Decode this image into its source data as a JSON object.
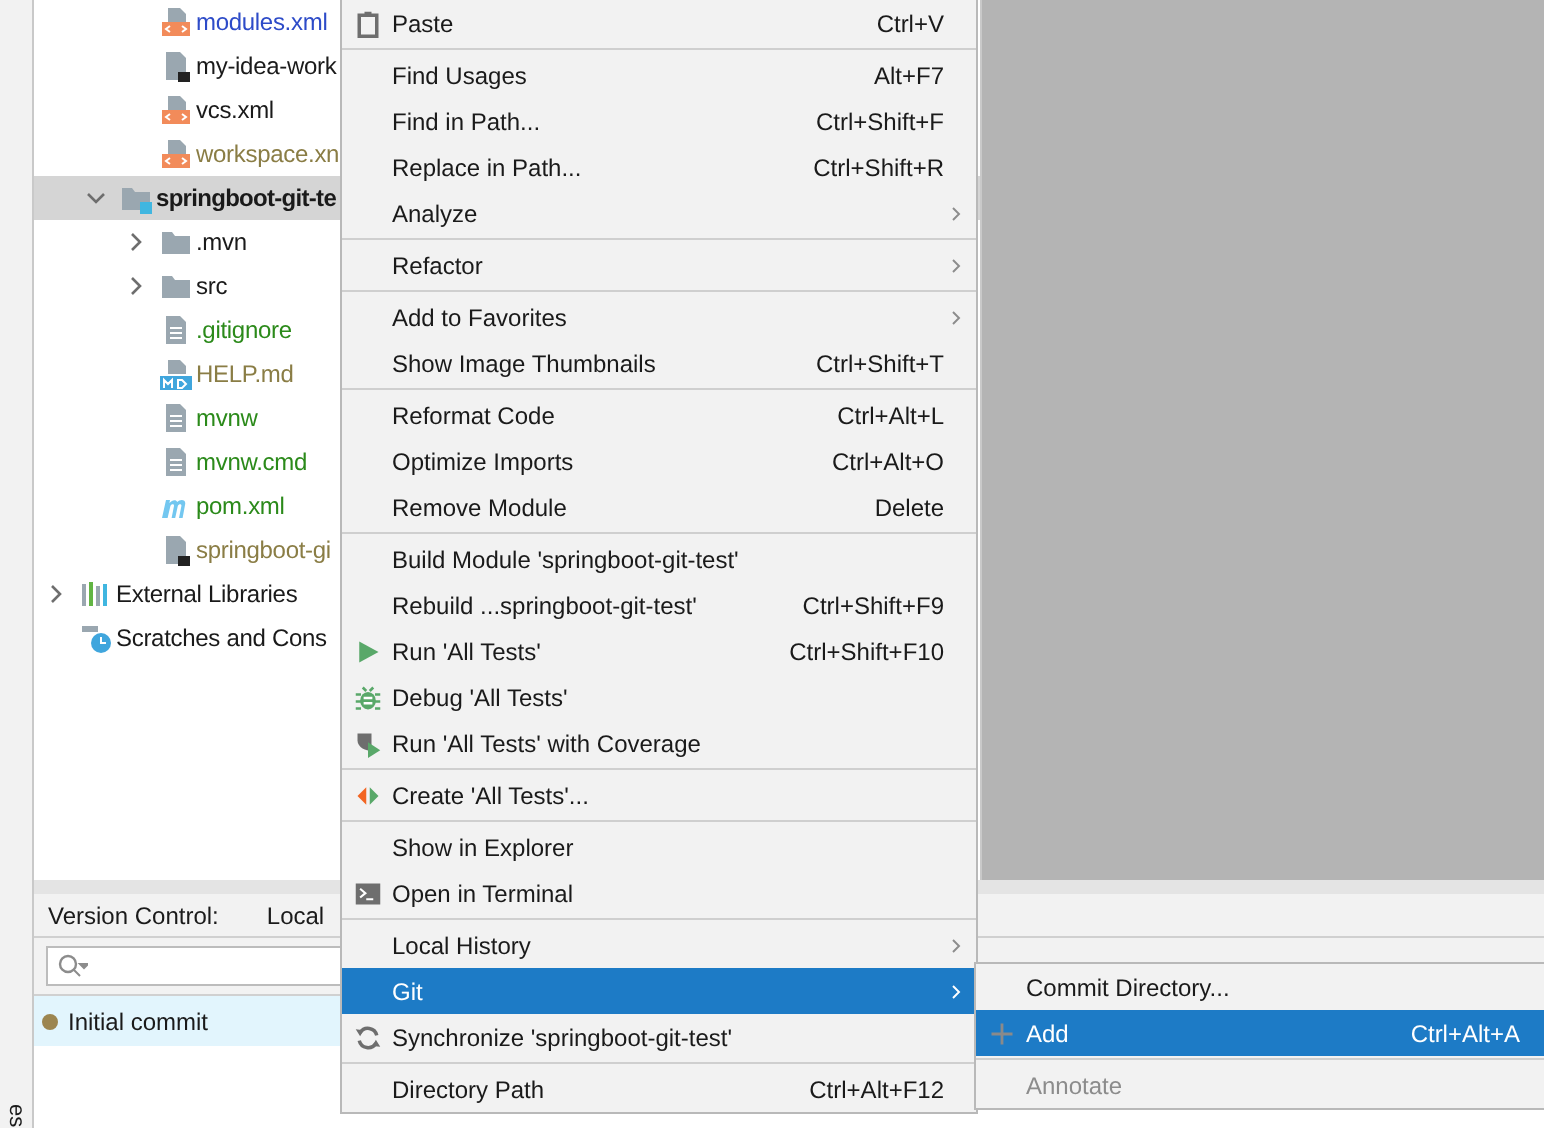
{
  "side_strip": {
    "label": "es"
  },
  "project_tree": [
    {
      "children": [
        {
          "children": [
            {
              "name": "modules.xml",
              "kind": "xml",
              "color": "#2d4bc8",
              "selected": false
            },
            {
              "name": "my-idea-work",
              "kind": "hidden-file",
              "color": "#1a1a1a",
              "selected": false
            },
            {
              "name": "vcs.xml",
              "kind": "xml",
              "color": "#1a1a1a",
              "selected": false
            },
            {
              "name": "workspace.xn",
              "kind": "xml",
              "color": "#8a7d45",
              "selected": false
            }
          ]
        },
        {
          "name": "springboot-git-te",
          "kind": "module",
          "color": "#1a1a1a",
          "expanded": true,
          "selected": true,
          "children": [
            {
              "name": ".mvn",
              "kind": "folder",
              "color": "#1a1a1a",
              "expanded": false,
              "selected": false
            },
            {
              "name": "src",
              "kind": "folder",
              "color": "#1a1a1a",
              "expanded": false,
              "selected": false
            },
            {
              "name": ".gitignore",
              "kind": "text",
              "color": "#2b8a1a",
              "selected": false
            },
            {
              "name": "HELP.md",
              "kind": "md",
              "color": "#8a7d45",
              "selected": false
            },
            {
              "name": "mvnw",
              "kind": "text",
              "color": "#2b8a1a",
              "selected": false
            },
            {
              "name": "mvnw.cmd",
              "kind": "text",
              "color": "#2b8a1a",
              "selected": false
            },
            {
              "name": "pom.xml",
              "kind": "maven",
              "color": "#2b8a1a",
              "selected": false
            },
            {
              "name": "springboot-gi",
              "kind": "hidden-file",
              "color": "#8a7d45",
              "selected": false
            }
          ]
        }
      ]
    },
    {
      "name": "External Libraries",
      "kind": "libraries",
      "color": "#1a1a1a",
      "expanded": false,
      "selected": false
    },
    {
      "name": "Scratches and Cons",
      "kind": "scratches",
      "color": "#1a1a1a",
      "selected": false
    }
  ],
  "version_control": {
    "title": "Version Control:",
    "tabs": [
      {
        "label": "Local",
        "selected": false
      }
    ],
    "commits": [
      {
        "message": "Initial commit",
        "color": "#9c8550",
        "selected": true
      }
    ]
  },
  "context_menu": {
    "groups": [
      [
        {
          "label": "Paste",
          "shortcut": "Ctrl+V",
          "kind": "paste",
          "submenu": false,
          "selected": false
        }
      ],
      [
        {
          "label": "Find Usages",
          "shortcut": "Alt+F7",
          "submenu": false,
          "selected": false
        },
        {
          "label": "Find in Path...",
          "shortcut": "Ctrl+Shift+F",
          "submenu": false,
          "selected": false
        },
        {
          "label": "Replace in Path...",
          "shortcut": "Ctrl+Shift+R",
          "submenu": false,
          "selected": false
        },
        {
          "label": "Analyze",
          "submenu": true,
          "selected": false
        }
      ],
      [
        {
          "label": "Refactor",
          "submenu": true,
          "selected": false
        }
      ],
      [
        {
          "label": "Add to Favorites",
          "submenu": true,
          "selected": false
        },
        {
          "label": "Show Image Thumbnails",
          "shortcut": "Ctrl+Shift+T",
          "submenu": false,
          "selected": false
        }
      ],
      [
        {
          "label": "Reformat Code",
          "shortcut": "Ctrl+Alt+L",
          "submenu": false,
          "selected": false
        },
        {
          "label": "Optimize Imports",
          "shortcut": "Ctrl+Alt+O",
          "submenu": false,
          "selected": false
        },
        {
          "label": "Remove Module",
          "shortcut": "Delete",
          "submenu": false,
          "selected": false
        }
      ],
      [
        {
          "label": "Build Module 'springboot-git-test'",
          "submenu": false,
          "selected": false
        },
        {
          "label": "Rebuild ...springboot-git-test'",
          "shortcut": "Ctrl+Shift+F9",
          "submenu": false,
          "selected": false
        },
        {
          "label": "Run 'All Tests'",
          "shortcut": "Ctrl+Shift+F10",
          "kind": "run",
          "submenu": false,
          "selected": false
        },
        {
          "label": "Debug 'All Tests'",
          "kind": "debug",
          "submenu": false,
          "selected": false
        },
        {
          "label": "Run 'All Tests' with Coverage",
          "kind": "coverage",
          "submenu": false,
          "selected": false
        }
      ],
      [
        {
          "label": "Create 'All Tests'...",
          "kind": "create",
          "submenu": false,
          "selected": false
        }
      ],
      [
        {
          "label": "Show in Explorer",
          "submenu": false,
          "selected": false
        },
        {
          "label": "Open in Terminal",
          "kind": "terminal",
          "submenu": false,
          "selected": false
        }
      ],
      [
        {
          "label": "Local History",
          "submenu": true,
          "selected": false
        },
        {
          "label": "Git",
          "submenu": true,
          "selected": true
        },
        {
          "label": "Synchronize 'springboot-git-test'",
          "kind": "sync",
          "submenu": false,
          "selected": false
        }
      ],
      [
        {
          "label": "Directory Path",
          "shortcut": "Ctrl+Alt+F12",
          "submenu": false,
          "selected": false
        }
      ]
    ]
  },
  "git_submenu": {
    "groups": [
      [
        {
          "label": "Commit Directory...",
          "disabled": false,
          "selected": false
        },
        {
          "label": "Add",
          "shortcut": "Ctrl+Alt+A",
          "kind": "plus",
          "disabled": false,
          "selected": true
        }
      ],
      [
        {
          "label": "Annotate",
          "disabled": true,
          "selected": false
        }
      ]
    ]
  }
}
